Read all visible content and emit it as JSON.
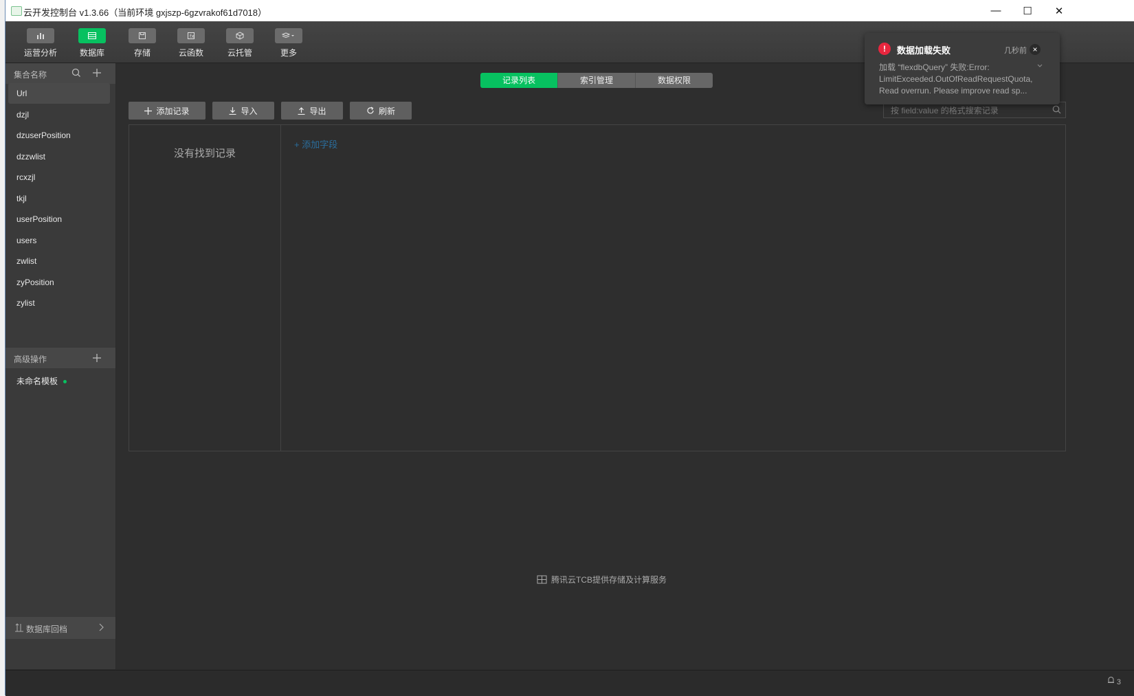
{
  "window": {
    "title": "云开发控制台 v1.3.66（当前环境 gxjszp-6gzvrakof61d7018）",
    "minimize": "—",
    "maximize": "☐",
    "close": "✕"
  },
  "toolbar": {
    "items": [
      {
        "label": "运营分析",
        "icon": "chart-icon"
      },
      {
        "label": "数据库",
        "icon": "database-icon",
        "active": true
      },
      {
        "label": "存储",
        "icon": "storage-icon"
      },
      {
        "label": "云函数",
        "icon": "function-icon"
      },
      {
        "label": "云托管",
        "icon": "cube-icon"
      },
      {
        "label": "更多",
        "icon": "layers-icon"
      }
    ]
  },
  "sidebar": {
    "header": "集合名称",
    "collections": [
      "Url",
      "dzjl",
      "dzuserPosition",
      "dzzwlist",
      "rcxzjl",
      "tkjl",
      "userPosition",
      "users",
      "zwlist",
      "zyPosition",
      "zylist"
    ],
    "advanced_header": "高级操作",
    "templates": [
      "未命名模板"
    ],
    "footer": "数据库回档"
  },
  "main": {
    "tabs": [
      "记录列表",
      "索引管理",
      "数据权限"
    ],
    "actions": {
      "add_record": "添加记录",
      "import": "导入",
      "export": "导出",
      "refresh": "刷新"
    },
    "search_placeholder": "按 field:value 的格式搜索记录",
    "empty_text": "没有找到记录",
    "add_field": "添加字段",
    "footer_note": "腾讯云TCB提供存储及计算服务"
  },
  "toast": {
    "title": "数据加载失败",
    "time": "几秒前",
    "message": "加载 “flexdbQuery” 失败:Error: LimitExceeded.OutOfReadRequestQuota, Read overrun. Please improve read sp...",
    "color": "#e8263e"
  },
  "status": {
    "notifications": "3"
  },
  "colors": {
    "accent": "#07c160",
    "background": "#2e2e2e"
  }
}
